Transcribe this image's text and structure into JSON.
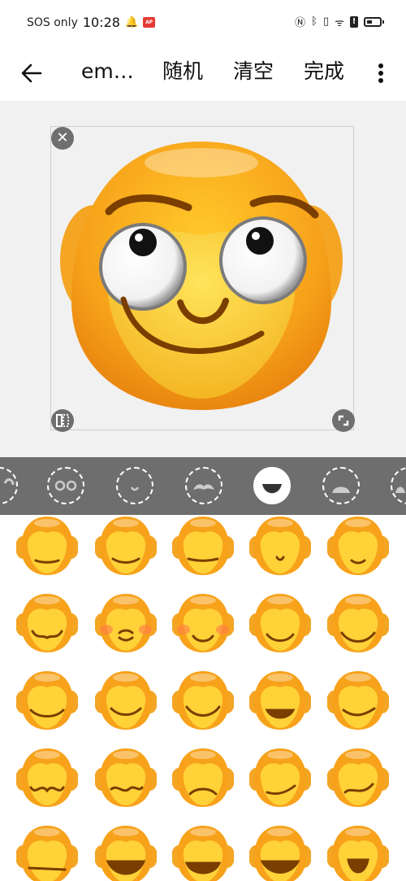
{
  "status_bar": {
    "carrier": "SOS only",
    "time": "10:28",
    "badge_text": "AP"
  },
  "app_bar": {
    "title": "em…",
    "random_label": "随机",
    "clear_label": "清空",
    "done_label": "完成"
  },
  "editor": {
    "close_icon": "close-icon",
    "flip_icon": "flip-icon",
    "resize_icon": "resize-icon"
  },
  "categories": [
    {
      "name": "face-outline",
      "selected": false
    },
    {
      "name": "eyes",
      "selected": false
    },
    {
      "name": "mouth-small",
      "selected": false
    },
    {
      "name": "mustache",
      "selected": false
    },
    {
      "name": "mouth",
      "selected": true
    },
    {
      "name": "chin",
      "selected": false
    },
    {
      "name": "extra",
      "selected": false
    }
  ],
  "colors": {
    "face": "#f7a21a",
    "face_light": "#ffd238",
    "mouth": "#7a3e00",
    "category_bar": "#6e6e6e",
    "canvas_bg": "#f1f1f1"
  },
  "mouth_grid": {
    "rows": 5,
    "cols": 5,
    "styles": [
      "neutral-line",
      "flat-smile",
      "long-line",
      "small-o",
      "small-smile",
      "wavy-cheeks",
      "pursed-blush",
      "blush-smile",
      "smile",
      "wide-smile",
      "grin",
      "grin-line",
      "smile-wide",
      "open-smile",
      "slant-smile",
      "wavy",
      "wavy-2",
      "frown",
      "smirk",
      "crooked",
      "flat",
      "open-big",
      "open-teeth",
      "open-wide",
      "open-laugh"
    ]
  }
}
